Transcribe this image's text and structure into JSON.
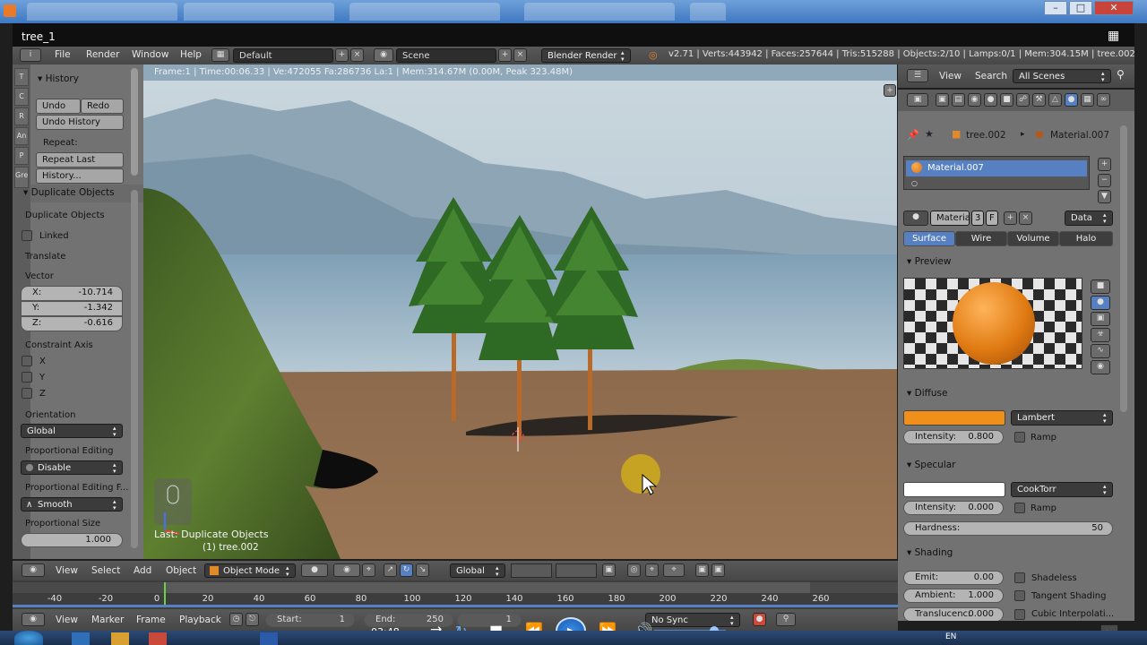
{
  "window": {
    "title": "tree_1"
  },
  "top_header": {
    "menus": [
      "File",
      "Render",
      "Window",
      "Help"
    ],
    "layout": "Default",
    "scene": "Scene",
    "engine": "Blender Render",
    "stats": "v2.71 | Verts:443942 | Faces:257644 | Tris:515288 | Objects:2/10 | Lamps:0/1 | Mem:304.15M | tree.002"
  },
  "viewport": {
    "info": "Frame:1 | Time:00:06.33 | Ve:472055 Fa:286736 La:1 | Mem:314.67M (0.00M, Peak 323.48M)",
    "last_op": "Last: Duplicate Objects",
    "object_name": "(1) tree.002"
  },
  "tool_tabs": [
    "T",
    "C",
    "R",
    "An",
    "P",
    "Gre"
  ],
  "history_panel": {
    "title": "History",
    "undo": "Undo",
    "redo": "Redo",
    "undo_history": "Undo History",
    "repeat_label": "Repeat:",
    "repeat_last": "Repeat Last",
    "history": "History..."
  },
  "operator_panel": {
    "title": "Duplicate Objects",
    "subtitle": "Duplicate Objects",
    "linked": "Linked",
    "translate": "Translate",
    "vector_label": "Vector",
    "vector": [
      {
        "k": "X:",
        "v": "-10.714"
      },
      {
        "k": "Y:",
        "v": "-1.342"
      },
      {
        "k": "Z:",
        "v": "-0.616"
      }
    ],
    "constraint_label": "Constraint Axis",
    "axes": [
      "X",
      "Y",
      "Z"
    ],
    "orientation_label": "Orientation",
    "orientation": "Global",
    "prop_edit_label": "Proportional Editing",
    "prop_edit": "Disable",
    "prop_falloff_label": "Proportional Editing F...",
    "prop_falloff": "Smooth",
    "prop_size_label": "Proportional Size",
    "prop_size": "1.000"
  },
  "viewport_header": {
    "menus": [
      "View",
      "Select",
      "Add",
      "Object"
    ],
    "mode": "Object Mode",
    "orientation": "Global"
  },
  "timeline": {
    "ticks": [
      "-40",
      "-20",
      "0",
      "20",
      "40",
      "60",
      "80",
      "100",
      "120",
      "140",
      "160",
      "180",
      "200",
      "220",
      "240",
      "260"
    ]
  },
  "timeline_header": {
    "menus": [
      "View",
      "Marker",
      "Frame",
      "Playback"
    ],
    "start_label": "Start:",
    "start": "1",
    "end_label": "End:",
    "end": "250",
    "current": "1",
    "sync": "No Sync"
  },
  "outliner_header": {
    "view": "View",
    "search": "Search",
    "scenes": "All Scenes"
  },
  "properties": {
    "breadcrumb_object": "tree.002",
    "breadcrumb_material": "Material.007",
    "slot_name": "Material.007",
    "material_field": "Materia",
    "users": "3",
    "fake_user": "F",
    "data": "Data",
    "tabs": [
      "Surface",
      "Wire",
      "Volume",
      "Halo"
    ],
    "preview_title": "Preview",
    "diffuse_title": "Diffuse",
    "diffuse_shader": "Lambert",
    "diffuse_intensity_label": "Intensity:",
    "diffuse_intensity": "0.800",
    "ramp": "Ramp",
    "specular_title": "Specular",
    "specular_shader": "CookTorr",
    "specular_intensity_label": "Intensity:",
    "specular_intensity": "0.000",
    "hardness_label": "Hardness:",
    "hardness": "50",
    "shading_title": "Shading",
    "emit_label": "Emit:",
    "emit": "0.00",
    "ambient_label": "Ambient:",
    "ambient": "1.000",
    "translucency_label": "Translucenc:",
    "translucency": "0.000",
    "shadeless": "Shadeless",
    "tangent_shading": "Tangent Shading",
    "cubic_interp": "Cubic Interpolati..."
  },
  "video_overlay": {
    "time": "03:48"
  },
  "taskbar": {
    "lang": "EN"
  },
  "colors": {
    "diffuse": "#f0901a",
    "specular": "#ffffff",
    "selection": "#5680c2",
    "panel": "#727272"
  }
}
